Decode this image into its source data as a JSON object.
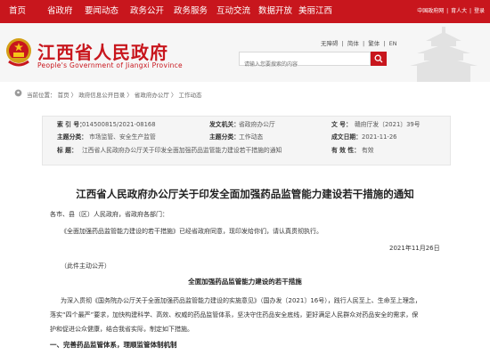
{
  "nav": {
    "items": [
      "首页",
      "省政府",
      "要闻动态",
      "政务公开",
      "政务服务",
      "互动交流",
      "数据开放",
      "美丽江西"
    ],
    "top_links": [
      "中国政府网",
      "|",
      "育人大",
      "|",
      "登录"
    ]
  },
  "header": {
    "site_name": "江西省人民政府",
    "site_subtitle": "People's Government of Jiangxi Province",
    "util_links": [
      "无障碍",
      "|",
      "简体",
      "|",
      "繁体",
      "|",
      "EN"
    ],
    "search_placeholder": "请输入您要搜索的内容"
  },
  "breadcrumb": {
    "text": "当前位置：  首页  〉 政府信息公开目录 〉 省政府办公厅  〉  工作动态"
  },
  "meta": {
    "index_label": "索   引   号：",
    "index_value": "014500815/2021-08168",
    "org_label": "发文机关：",
    "org_value": "省政府办公厅",
    "docno_label": "文    号：",
    "docno_value": "赣府厅发〔2021〕39号",
    "topic_label": "主题分类：",
    "topic_value": "市场监管、安全生产监管",
    "type_label": "主题分类：",
    "type_value": "工作动态",
    "date_label": "成文日期：",
    "date_value": "2021-11-26",
    "title_label": "标      题：",
    "title_value": "江西省人民政府办公厅关于印发全面加强药品监管能力建设若干措施的通知",
    "validity_label": "有 效 性：",
    "validity_value": "有效"
  },
  "article": {
    "title": "江西省人民政府办公厅关于印发全面加强药品监管能力建设若干措施的通知",
    "salutation": "各市、县（区）人民政府，省政府各部门：",
    "para1": "《全面加强药品监管能力建设的若干措施》已经省政府同意，现印发给你们，请认真贯彻执行。",
    "date": "2021年11月26日",
    "disclosure": "（此件主动公开）",
    "subtitle": "全面加强药品监管能力建设的若干措施",
    "body_line1": "为深入贯彻《国务院办公厅关于全面加强药品监管能力建设的实施意见》（国办发〔2021〕16号），践行人民至上、生命至上理念，",
    "body_line2": "落实“四个最严”要求，加快构建科学、高效、权威的药品监管体系，坚决守住药品安全底线，更好满足人民群众对药品安全的需求，保",
    "body_line3": "护和促进公众健康，结合我省实际，制定如下措施。",
    "section1": "一、完善药品监管体系，理顺监管体制机制"
  },
  "colors": {
    "brand_red": "#c8161d",
    "meta_bg": "#f5f5f5"
  },
  "icons": {
    "emblem": "national-emblem-icon",
    "search": "search-icon",
    "breadcrumb": "location-icon"
  }
}
